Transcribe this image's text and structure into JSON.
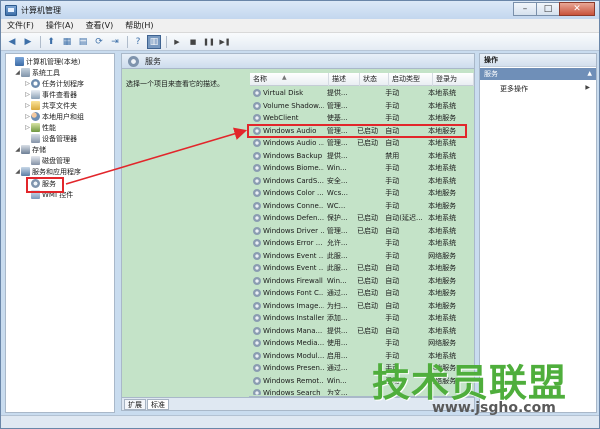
{
  "window": {
    "title": "计算机管理"
  },
  "menu": [
    "文件(F)",
    "操作(A)",
    "查看(V)",
    "帮助(H)"
  ],
  "tree": {
    "root": "计算机管理(本地)",
    "system_tools": "系统工具",
    "task_scheduler": "任务计划程序",
    "event_viewer": "事件查看器",
    "shared_folders": "共享文件夹",
    "local_users": "本地用户和组",
    "performance": "性能",
    "device_manager": "设备管理器",
    "storage": "存储",
    "disk_management": "磁盘管理",
    "services_apps": "服务和应用程序",
    "services": "服务",
    "wmi": "WMI 控件"
  },
  "center": {
    "header_title": "服务",
    "description_hint": "选择一个项目来查看它的描述。",
    "columns": [
      "名称",
      "描述",
      "状态",
      "启动类型",
      "登录为"
    ],
    "rows": [
      [
        "Virtual Disk",
        "提供...",
        "",
        "手动",
        "本地系统"
      ],
      [
        "Volume Shadow...",
        "管理...",
        "",
        "手动",
        "本地系统"
      ],
      [
        "WebClient",
        "使基...",
        "",
        "手动",
        "本地服务"
      ],
      [
        "Windows Audio",
        "管理...",
        "已启动",
        "自动",
        "本地服务"
      ],
      [
        "Windows Audio ...",
        "管理...",
        "已启动",
        "自动",
        "本地系统"
      ],
      [
        "Windows Backup",
        "提供...",
        "",
        "禁用",
        "本地系统"
      ],
      [
        "Windows Biome...",
        "Win...",
        "",
        "手动",
        "本地系统"
      ],
      [
        "Windows CardS...",
        "安全...",
        "",
        "手动",
        "本地系统"
      ],
      [
        "Windows Color ...",
        "Wcs...",
        "",
        "手动",
        "本地服务"
      ],
      [
        "Windows Conne...",
        "WC...",
        "",
        "手动",
        "本地服务"
      ],
      [
        "Windows Defen...",
        "保护...",
        "已启动",
        "自动(延迟...",
        "本地系统"
      ],
      [
        "Windows Driver ...",
        "管理...",
        "已启动",
        "自动",
        "本地系统"
      ],
      [
        "Windows Error ...",
        "允许...",
        "",
        "手动",
        "本地系统"
      ],
      [
        "Windows Event ...",
        "此服...",
        "",
        "手动",
        "网络服务"
      ],
      [
        "Windows Event ...",
        "此服...",
        "已启动",
        "自动",
        "本地服务"
      ],
      [
        "Windows Firewall",
        "Win...",
        "已启动",
        "自动",
        "本地服务"
      ],
      [
        "Windows Font C...",
        "通过...",
        "已启动",
        "自动",
        "本地服务"
      ],
      [
        "Windows Image...",
        "为扫...",
        "已启动",
        "自动",
        "本地服务"
      ],
      [
        "Windows Installer",
        "添加...",
        "",
        "手动",
        "本地系统"
      ],
      [
        "Windows Mana...",
        "提供...",
        "已启动",
        "自动",
        "本地系统"
      ],
      [
        "Windows Media...",
        "使用...",
        "",
        "手动",
        "网络服务"
      ],
      [
        "Windows Modul...",
        "启用...",
        "",
        "手动",
        "本地系统"
      ],
      [
        "Windows Presen...",
        "通过...",
        "",
        "手动",
        "本地服务"
      ],
      [
        "Windows Remot...",
        "Win...",
        "",
        "手动",
        "网络服务"
      ],
      [
        "Windows Search",
        "为文...",
        "",
        "",
        ""
      ]
    ]
  },
  "tabs": [
    "扩展",
    "标准"
  ],
  "actions": {
    "title": "操作",
    "section": "服务",
    "more": "更多操作"
  },
  "watermark": {
    "text": "技术员联盟",
    "url": "www.jsgho.com"
  },
  "colors": {
    "highlight": "#e2262b",
    "list_bg": "#c4e3c8",
    "watermark": "#4fae3c"
  }
}
